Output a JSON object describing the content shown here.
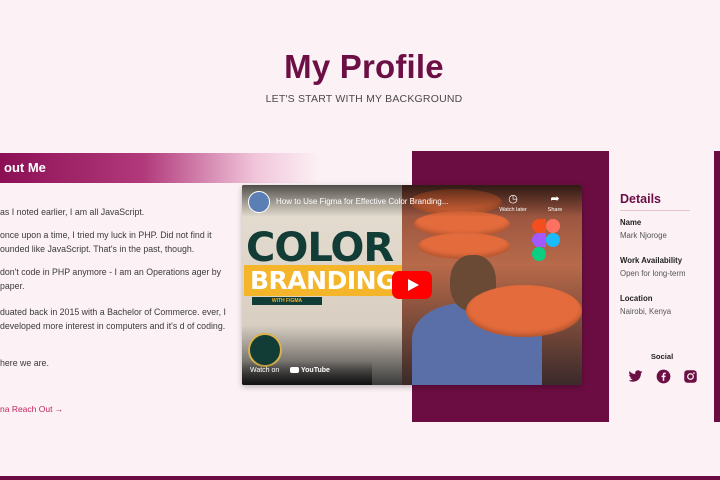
{
  "header": {
    "title": "My Profile",
    "subtitle": "LET'S START WITH MY BACKGROUND"
  },
  "about": {
    "heading": "out Me",
    "paragraphs": [
      "as I noted earlier, I am all JavaScript.",
      "once upon a time, I tried my luck in PHP. Did not find it ounded like JavaScript. That's in the past, though.",
      "don't code in PHP anymore - I am an Operations ager by paper.",
      "duated back in 2015 with a Bachelor of Commerce. ever, I developed more interest in computers and it's d of coding.",
      "here we are."
    ],
    "reach_out": "na Reach Out →"
  },
  "video": {
    "title": "How to Use Figma for Effective Color Branding...",
    "watch_later": "Watch later",
    "share": "Share",
    "brand_line1": "COLOR",
    "brand_line2": "BRANDING",
    "with_figma": "WITH FIGMA",
    "watch_on": "Watch on",
    "youtube": "YouTube"
  },
  "details": {
    "title": "Details",
    "items": [
      {
        "label": "Name",
        "value": "Mark Njoroge"
      },
      {
        "label": "Work Availability",
        "value": "Open for long-term"
      },
      {
        "label": "Location",
        "value": "Nairobi, Kenya"
      }
    ],
    "social_title": "Social",
    "social_icons": [
      "twitter-icon",
      "facebook-icon",
      "instagram-icon"
    ]
  },
  "colors": {
    "brand": "#6b0f45",
    "accent": "#c4245f",
    "background": "#fcf1f5"
  }
}
